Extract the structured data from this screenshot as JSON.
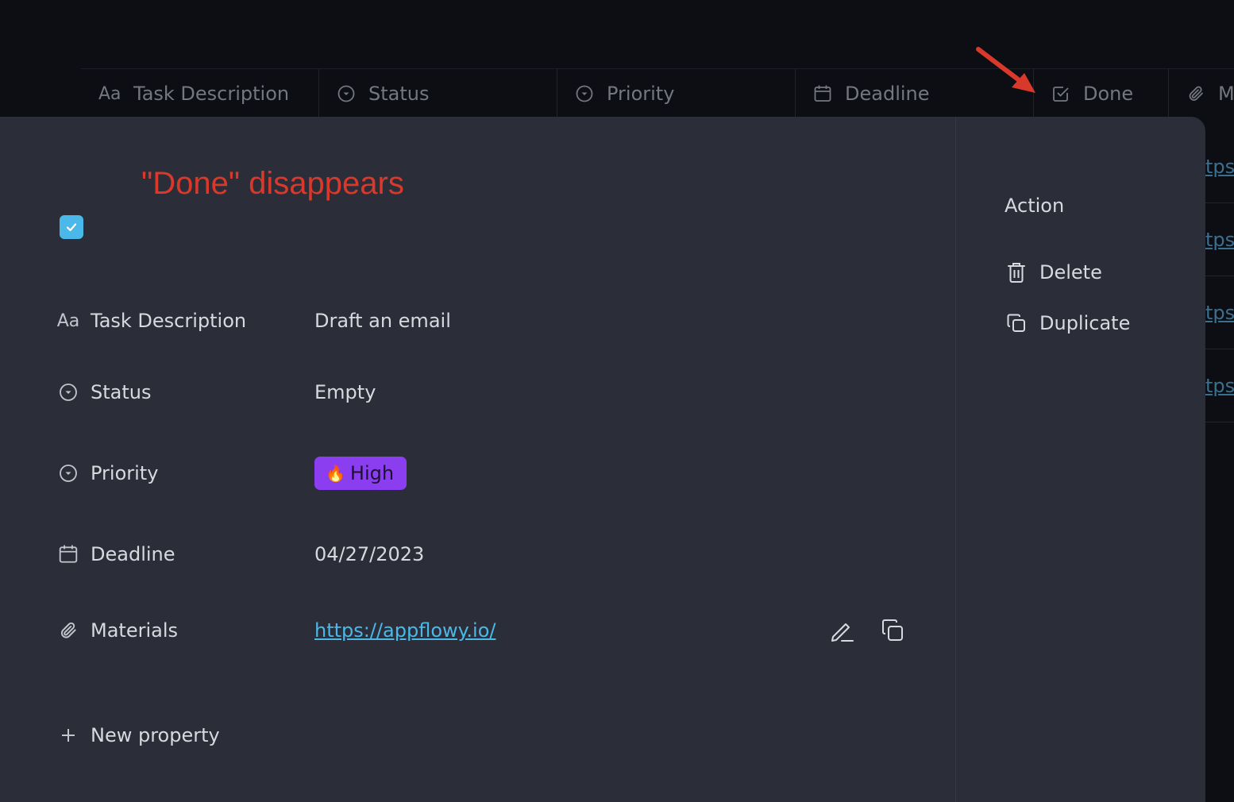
{
  "grid": {
    "columns": [
      {
        "label": "Task Description",
        "icon": "text-aa-icon",
        "width": 300
      },
      {
        "label": "Status",
        "icon": "select-icon",
        "width": 300
      },
      {
        "label": "Priority",
        "icon": "select-icon",
        "width": 300
      },
      {
        "label": "Deadline",
        "icon": "calendar-icon",
        "width": 300
      },
      {
        "label": "Done",
        "icon": "checkbox-icon",
        "width": 170
      },
      {
        "label": "M",
        "icon": "paperclip-icon",
        "width": 82
      }
    ],
    "aa_glyph": "Aa",
    "link_fragment": "tps"
  },
  "annotation": {
    "text": "\"Done\" disappears",
    "color": "#d9392b"
  },
  "row_detail": {
    "done_checked": true,
    "properties": {
      "task_description": {
        "label": "Task Description",
        "value": "Draft an email",
        "icon_glyph": "Aa"
      },
      "status": {
        "label": "Status",
        "value": "Empty"
      },
      "priority": {
        "label": "Priority",
        "value": "High",
        "tag_color": "#8a3ef0",
        "emoji": "🔥"
      },
      "deadline": {
        "label": "Deadline",
        "value": "04/27/2023"
      },
      "materials": {
        "label": "Materials",
        "value": "https://appflowy.io/"
      }
    },
    "new_property_label": "New property"
  },
  "actions": {
    "title": "Action",
    "delete_label": "Delete",
    "duplicate_label": "Duplicate"
  },
  "colors": {
    "background": "#0d0e13",
    "modal": "#2b2e38",
    "accent": "#4ab8e8"
  }
}
